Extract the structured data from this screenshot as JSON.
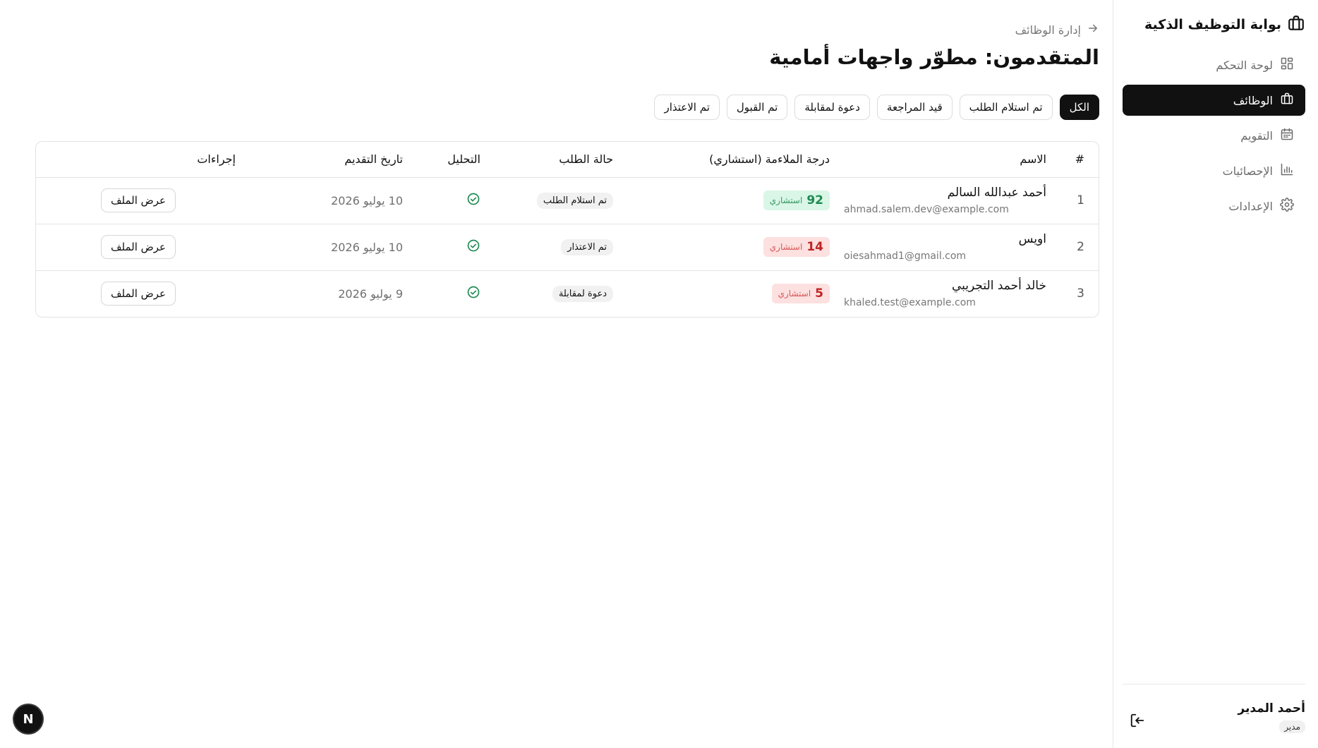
{
  "sidebar": {
    "brand": "بوابة التوظيف الذكية",
    "items": [
      {
        "label": "لوحة التحكم",
        "icon": "dashboard-grid-icon",
        "active": false
      },
      {
        "label": "الوظائف",
        "icon": "briefcase-icon",
        "active": true
      },
      {
        "label": "التقويم",
        "icon": "calendar-icon",
        "active": false
      },
      {
        "label": "الإحصائيات",
        "icon": "bar-chart-icon",
        "active": false
      },
      {
        "label": "الإعدادات",
        "icon": "gear-icon",
        "active": false
      }
    ],
    "user": {
      "name": "أحمد المدير",
      "role": "مدير"
    }
  },
  "header": {
    "back_label": "إدارة الوظائف",
    "title": "المتقدمون: مطوّر واجهات أمامية"
  },
  "filters": [
    "الكل",
    "تم استلام الطلب",
    "قيد المراجعة",
    "دعوة لمقابلة",
    "تم القبول",
    "تم الاعتذار"
  ],
  "active_filter": "الكل",
  "table": {
    "columns": [
      "#",
      "الاسم",
      "درجة الملاءمة (استشاري)",
      "حالة الطلب",
      "التحليل",
      "تاريخ التقديم",
      "إجراءات"
    ],
    "rows": [
      {
        "num": "1",
        "name": "أحمد عبدالله السالم",
        "email": "ahmad.salem.dev@example.com",
        "score": "92",
        "score_label": "استشاري",
        "status": "تم استلام الطلب",
        "date": "10 يوليو 2026",
        "action": "عرض الملف"
      },
      {
        "num": "2",
        "name": "اويس",
        "email": "oiesahmad1@gmail.com",
        "score": "14",
        "score_label": "استشاري",
        "status": "تم الاعتذار",
        "date": "10 يوليو 2026",
        "action": "عرض الملف"
      },
      {
        "num": "3",
        "name": "خالد أحمد التجريبي",
        "email": "khaled.test@example.com",
        "score": "5",
        "score_label": "استشاري",
        "status": "دعوة لمقابلة",
        "date": "9 يوليو 2026",
        "action": "عرض الملف"
      }
    ]
  },
  "colors": {
    "score_high_bg": "#d9f6e6",
    "score_low_bg": "#fde0e0",
    "check_green": "#1e8a52"
  },
  "framework_badge": "N"
}
